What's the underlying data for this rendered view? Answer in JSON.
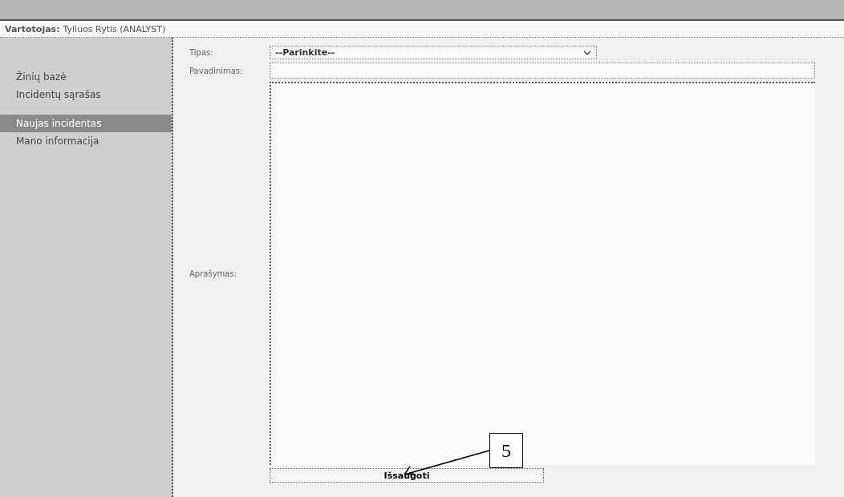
{
  "user_line": {
    "label": "Vartotojas:",
    "value": "Tyliuos Rytis (ANALYST)"
  },
  "sidebar": {
    "items": [
      {
        "label": "Žinių bazė",
        "selected": false
      },
      {
        "label": "Incidentų sąrašas",
        "selected": false
      },
      {
        "label": "Naujas incidentas",
        "selected": true
      },
      {
        "label": "Mano informacija",
        "selected": false
      }
    ]
  },
  "form": {
    "type_label": "Tipas:",
    "type_value": "--Parinkite--",
    "title_label": "Pavadinimas:",
    "description_label": "Aprašymas:",
    "save_button": "Išsaugoti"
  },
  "callout": {
    "label": "5"
  }
}
